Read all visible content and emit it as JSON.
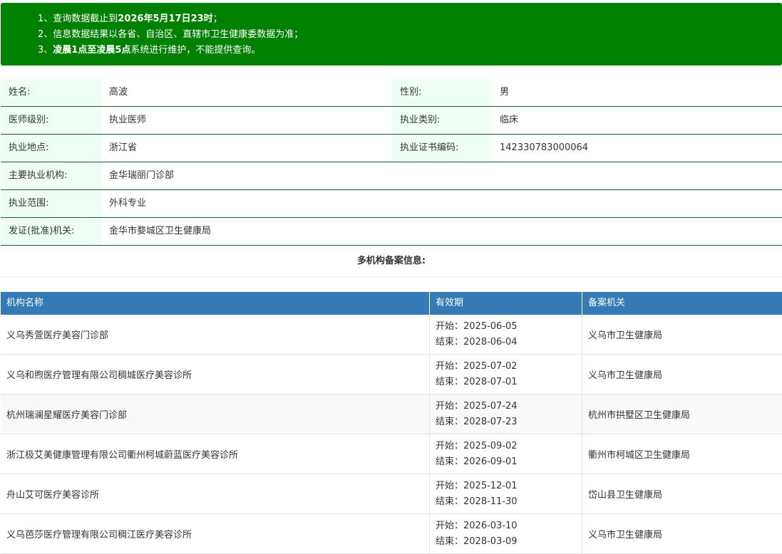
{
  "notice": {
    "line1_prefix": "1、查询数据截止到",
    "line1_bold": "2026年5月17日23时",
    "line1_suffix": "；",
    "line2": "2、信息数据结果以各省、自治区、直辖市卫生健康委数据为准；",
    "line3_prefix": "3、",
    "line3_bold": "凌晨1点至凌晨5点",
    "line3_suffix": "系统进行维护，不能提供查询。"
  },
  "info": {
    "name_label": "姓名:",
    "name": "高波",
    "gender_label": "性别:",
    "gender": "男",
    "level_label": "医师级别:",
    "level": "执业医师",
    "category_label": "执业类别:",
    "category": "临床",
    "location_label": "执业地点:",
    "location": "浙江省",
    "cert_label": "执业证书编码:",
    "cert": "142330783000064",
    "org_label": "主要执业机构:",
    "org": "金华瑞丽门诊部",
    "scope_label": "执业范围:",
    "scope": "外科专业",
    "authority_label": "发证(批准)机关:",
    "authority": "金华市婺城区卫生健康局"
  },
  "multi_title": "多机构备案信息:",
  "table": {
    "headers": [
      "机构名称",
      "有效期",
      "备案机关"
    ],
    "rows": [
      {
        "name": "义乌秀萱医疗美容门诊部",
        "start": "开始：2025-06-05",
        "end": "结束：2028-06-04",
        "authority": "义乌市卫生健康局"
      },
      {
        "name": "义乌和煦医疗管理有限公司稠城医疗美容诊所",
        "start": "开始：2025-07-02",
        "end": "结束：2028-07-01",
        "authority": "义乌市卫生健康局"
      },
      {
        "name": "杭州瑞澜星耀医疗美容门诊部",
        "start": "开始：2025-07-24",
        "end": "结束：2028-07-23",
        "authority": "杭州市拱墅区卫生健康局"
      },
      {
        "name": "浙江极艾美健康管理有限公司衢州柯城蔚蓝医疗美容诊所",
        "start": "开始：2025-09-02",
        "end": "结束：2026-09-01",
        "authority": "衢州市柯城区卫生健康局"
      },
      {
        "name": "舟山艾可医疗美容诊所",
        "start": "开始：2025-12-01",
        "end": "结束：2028-11-30",
        "authority": "岱山县卫生健康局"
      },
      {
        "name": "义乌芭莎医疗管理有限公司稠江医疗美容诊所",
        "start": "开始：2026-03-10",
        "end": "结束：2028-03-09",
        "authority": "义乌市卫生健康局"
      }
    ]
  },
  "colors": {
    "notice_bg": "#008000",
    "header_bg": "#337ab7",
    "label_bg": "#f0fff5",
    "row_border": "#1f5a36"
  }
}
